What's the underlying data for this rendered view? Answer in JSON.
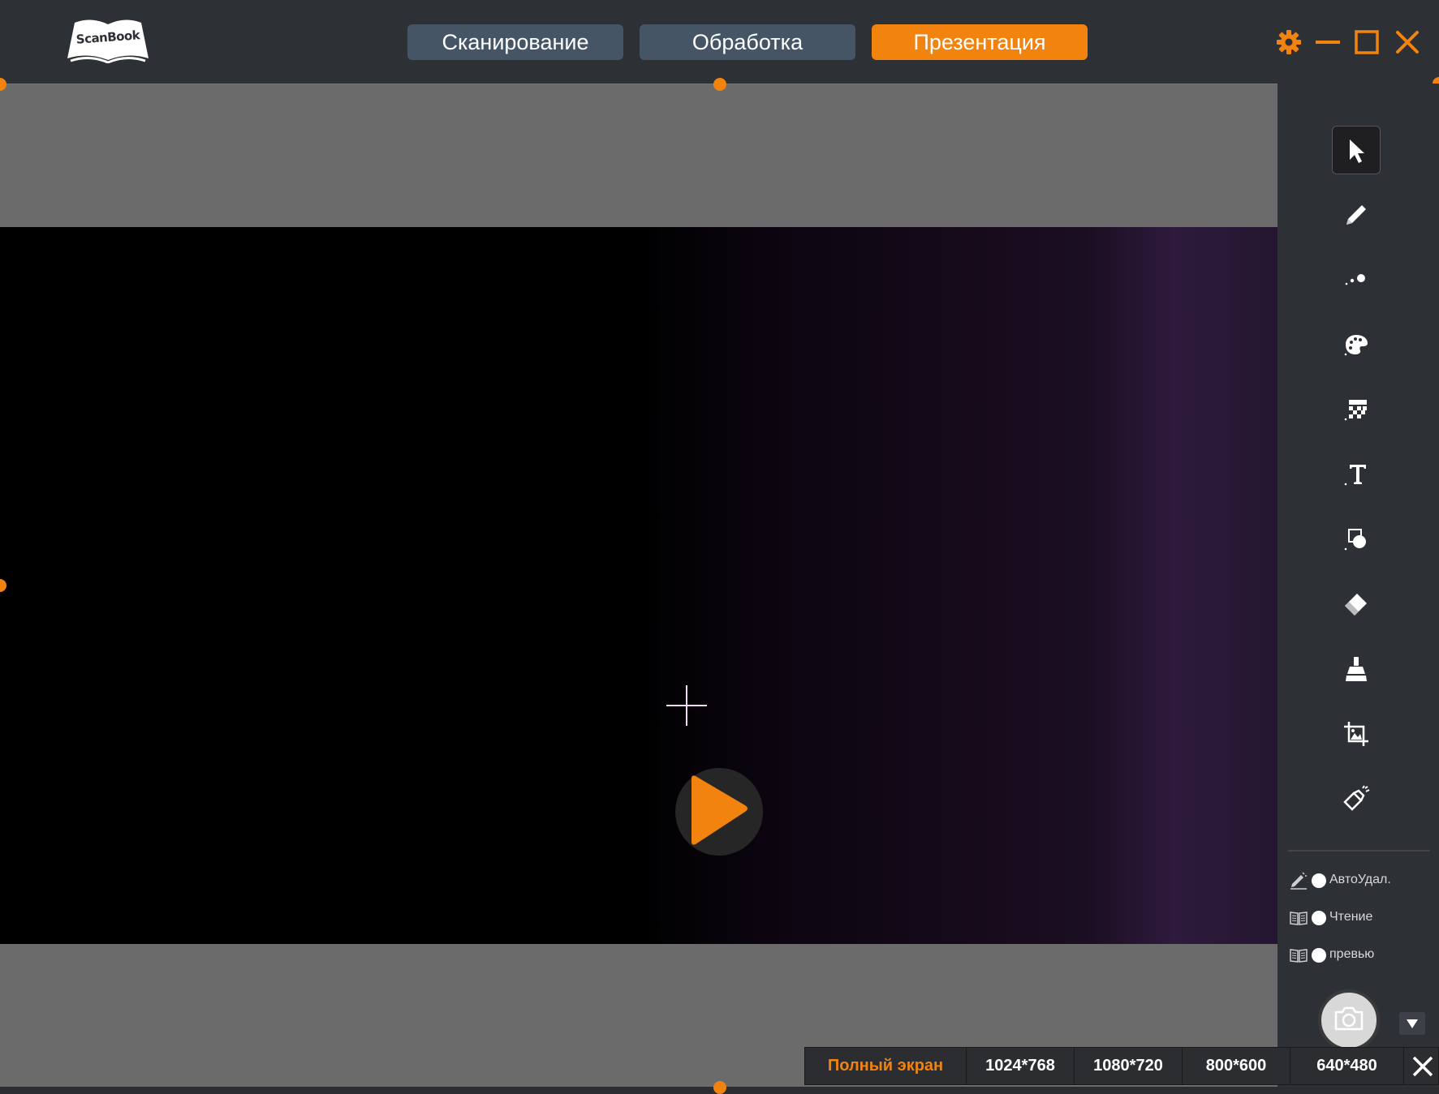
{
  "app": {
    "logo_text": "ScanBook"
  },
  "nav": {
    "tabs": [
      {
        "label": "Сканирование",
        "active": false
      },
      {
        "label": "Обработка",
        "active": false
      },
      {
        "label": "Презентация",
        "active": true
      }
    ]
  },
  "window_controls": [
    "gear-icon",
    "minimize-icon",
    "maximize-icon",
    "close-icon"
  ],
  "toolbar": {
    "tools": [
      {
        "icon": "pointer-icon",
        "selected": true
      },
      {
        "icon": "pencil-icon",
        "selected": false
      },
      {
        "icon": "line-width-icon",
        "selected": false
      },
      {
        "icon": "palette-icon",
        "selected": false
      },
      {
        "icon": "mosaic-icon",
        "selected": false
      },
      {
        "icon": "text-icon",
        "selected": false
      },
      {
        "icon": "shapes-icon",
        "selected": false
      },
      {
        "icon": "eraser-icon",
        "selected": false
      },
      {
        "icon": "clear-all-icon",
        "selected": false
      },
      {
        "icon": "crop-image-icon",
        "selected": false
      },
      {
        "icon": "spotlight-icon",
        "selected": false
      }
    ],
    "options": [
      {
        "label": "АвтоУдал.",
        "icon": "auto-erase-icon"
      },
      {
        "label": "Чтение",
        "icon": "book-icon"
      },
      {
        "label": "превью",
        "icon": "book-icon"
      }
    ]
  },
  "resolution_bar": {
    "options": [
      {
        "label": "Полный экран",
        "active": true
      },
      {
        "label": "1024*768",
        "active": false
      },
      {
        "label": "1080*720",
        "active": false
      },
      {
        "label": "800*600",
        "active": false
      },
      {
        "label": "640*480",
        "active": false
      }
    ]
  },
  "colors": {
    "accent": "#f2830f",
    "header_bg": "#2d3035",
    "tab_bg": "#465566",
    "stage_bg": "#6b6b6b"
  }
}
